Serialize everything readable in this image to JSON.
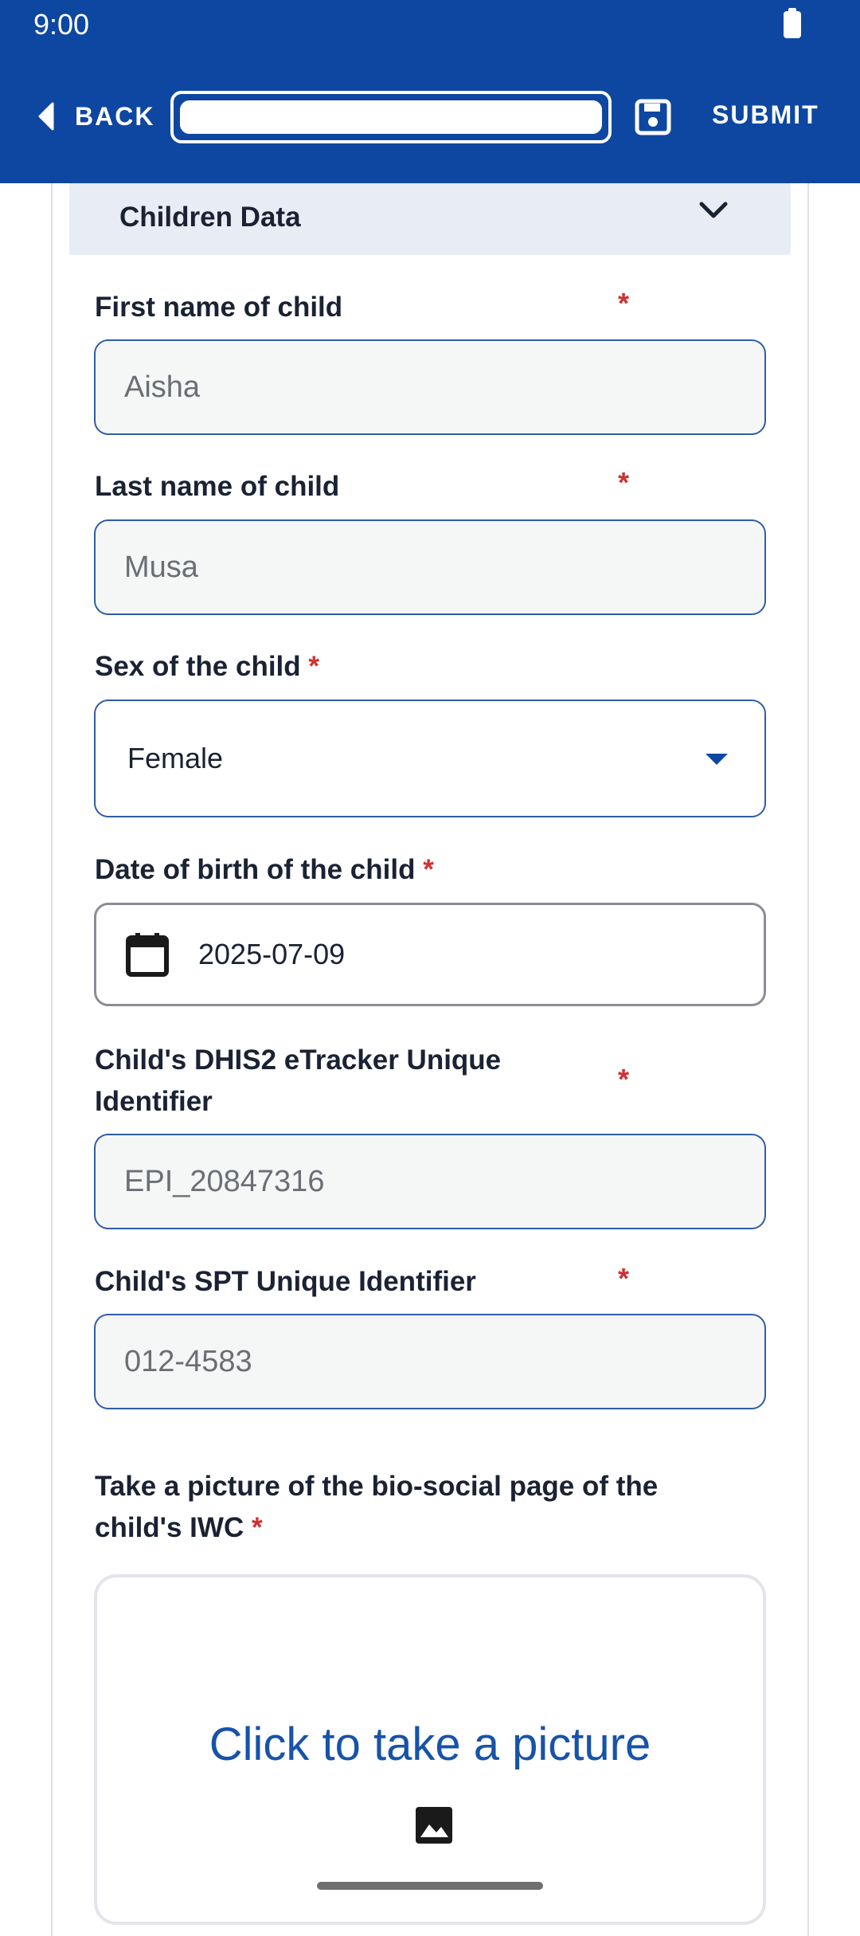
{
  "status_bar": {
    "time": "9:00"
  },
  "appbar": {
    "back_label": "BACK",
    "submit_label": "SUBMIT",
    "progress_percent": 100
  },
  "section": {
    "title": "Children Data"
  },
  "fields": {
    "first_name": {
      "label": "First name of child",
      "required": "*",
      "value": "Aisha"
    },
    "last_name": {
      "label": "Last name of child",
      "required": "*",
      "value": "Musa"
    },
    "sex": {
      "label": "Sex of the child",
      "required": "*",
      "value": "Female"
    },
    "dob": {
      "label": "Date of birth of the child",
      "required": "*",
      "value": "2025-07-09"
    },
    "dhis2": {
      "label_line1": "Child's DHIS2 eTracker Unique",
      "label_line2": "Identifier",
      "required": "*",
      "value": "EPI_20847316"
    },
    "spt": {
      "label": "Child's SPT Unique Identifier",
      "required": "*",
      "value": "012-4583"
    },
    "picture": {
      "label_line1": "Take a picture of the bio-social page of the",
      "label_line2": "child's IWC",
      "required": "*",
      "button": "Click to take a picture"
    }
  },
  "colors": {
    "primary": "#0e47a1",
    "required": "#d22f2f",
    "section_bg": "#e8ecf4"
  },
  "icons": [
    "battery-icon",
    "back-icon",
    "save-icon",
    "chevron-up-icon",
    "dropdown-icon",
    "calendar-icon",
    "image-icon"
  ]
}
